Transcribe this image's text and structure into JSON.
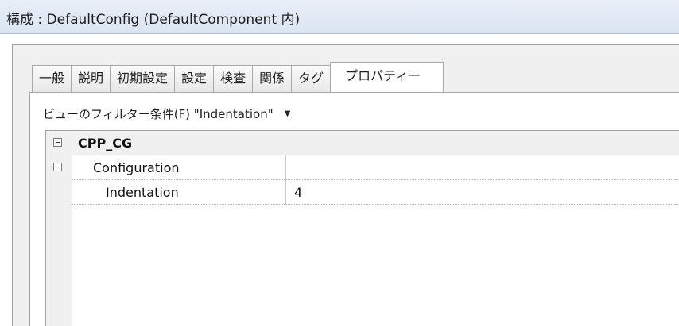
{
  "window": {
    "title": "構成 : DefaultConfig (DefaultComponent 内)"
  },
  "tabs": [
    {
      "label": "一般"
    },
    {
      "label": "説明"
    },
    {
      "label": "初期設定"
    },
    {
      "label": "設定"
    },
    {
      "label": "検査"
    },
    {
      "label": "関係"
    },
    {
      "label": "タグ"
    },
    {
      "label": "プロパティー",
      "active": true
    }
  ],
  "filter": {
    "label": "ビューのフィルター条件(F) \"Indentation\"",
    "arrow_icon": "dropdown-arrow-icon"
  },
  "properties": {
    "category": "CPP_CG",
    "group": "Configuration",
    "group_value": "",
    "items": [
      {
        "name": "Indentation",
        "value": "4"
      }
    ]
  },
  "colors": {
    "titlebar": "#dbe4f2",
    "panel": "#f0f0f0"
  }
}
